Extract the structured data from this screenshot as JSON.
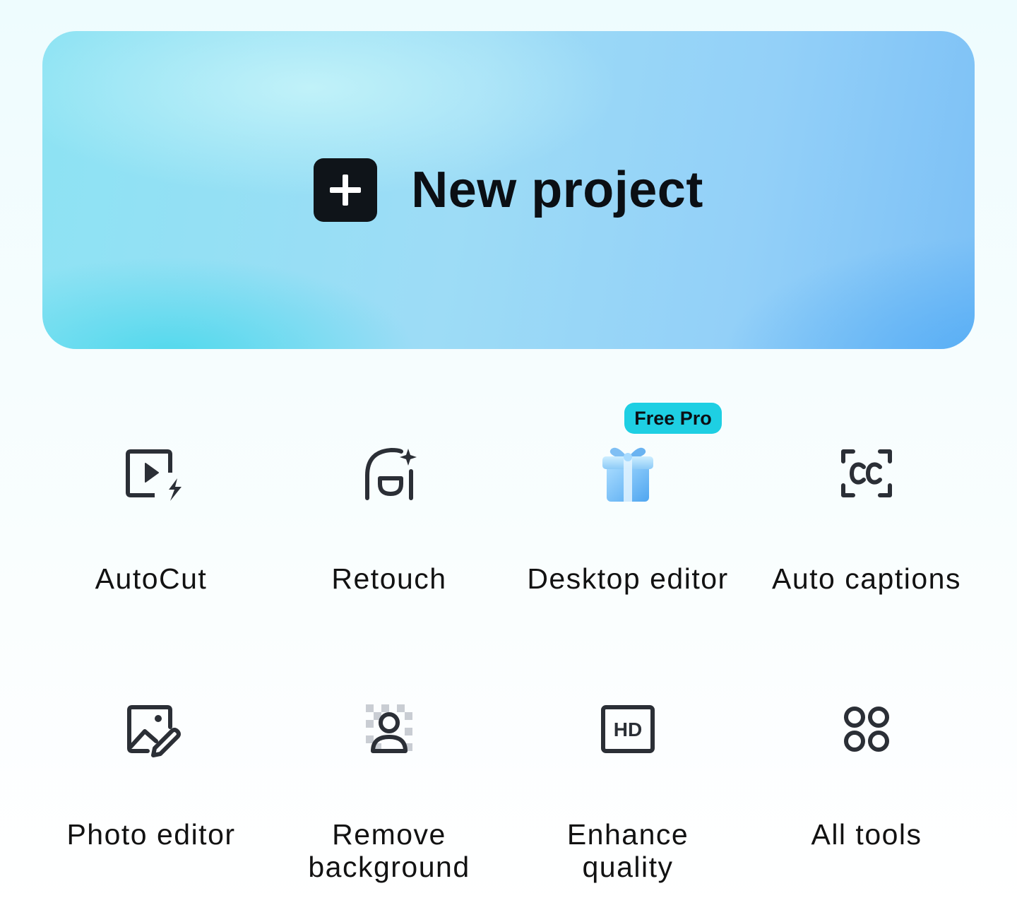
{
  "new_project": {
    "label": "New project",
    "icon": "plus-square-icon"
  },
  "tools": [
    {
      "label": "AutoCut",
      "icon": "video-lightning-icon"
    },
    {
      "label": "Retouch",
      "icon": "face-sparkle-icon"
    },
    {
      "label": "Desktop editor",
      "icon": "gift-box-icon",
      "badge": "Free Pro"
    },
    {
      "label": "Auto captions",
      "icon": "closed-captions-icon"
    },
    {
      "label": "Photo editor",
      "icon": "image-edit-icon"
    },
    {
      "label": "Remove background",
      "line1": "Remove",
      "line2": "background",
      "icon": "person-checkerboard-icon"
    },
    {
      "label": "Enhance quality",
      "line1": "Enhance",
      "line2": "quality",
      "icon": "hd-icon"
    },
    {
      "label": "All tools",
      "icon": "four-circles-icon"
    }
  ],
  "colors": {
    "badge": "#1ecfe3",
    "dark": "#0f1419",
    "icon_stroke": "#2b2f36",
    "banner_start": "#8de3f3",
    "banner_end": "#7cc0f6"
  }
}
